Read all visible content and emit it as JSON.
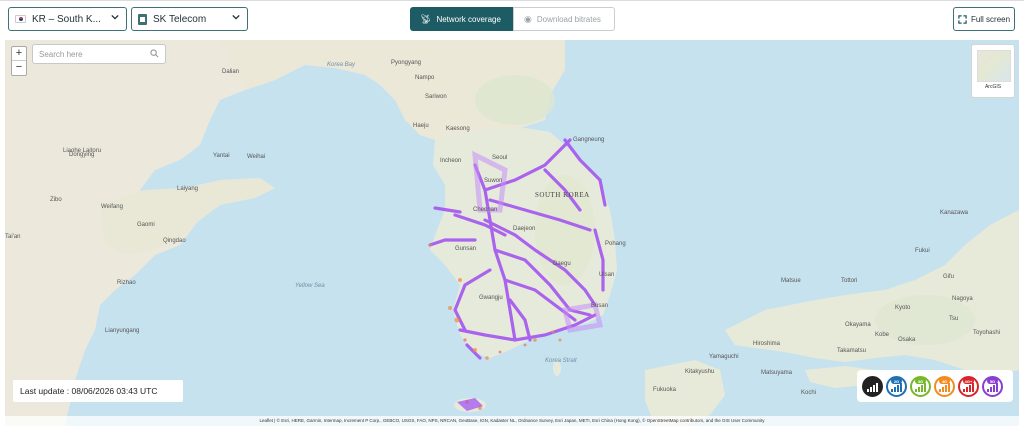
{
  "header": {
    "country_select": "KR – South K...",
    "operator_select": "SK Telecom",
    "tab_network": "Network coverage",
    "tab_bitrates": "Download bitrates",
    "fullscreen": "Full screen"
  },
  "map": {
    "zoom_in": "+",
    "zoom_out": "−",
    "search_placeholder": "Search here",
    "basemap_caption": "ArcGIS",
    "last_update": "Last update : 08/06/2026 03:43 UTC",
    "attribution": "Leaflet | © Esri, HERE, Garmin, Intermap, Increment P Corp., GEBCO, USGS, FAO, NPS, NRCAN, GeoBase, IGN, Kadaster NL, Ordnance Survey, Esri Japan, METI, Esri China (Hong Kong), © OpenStreetMap contributors, and the GIS User Community",
    "places": [
      {
        "name": "Dalian"
      },
      {
        "name": "Korea Bay"
      },
      {
        "name": "Pyongyang"
      },
      {
        "name": "Nampo"
      },
      {
        "name": "Sariwon"
      },
      {
        "name": "Haeju"
      },
      {
        "name": "Kaesong"
      },
      {
        "name": "Incheon"
      },
      {
        "name": "Seoul"
      },
      {
        "name": "Suwon"
      },
      {
        "name": "Gangneung"
      },
      {
        "name": "SOUTH KOREA"
      },
      {
        "name": "Cheonan"
      },
      {
        "name": "Daejeon"
      },
      {
        "name": "Pohang"
      },
      {
        "name": "Gunsan"
      },
      {
        "name": "Daegu"
      },
      {
        "name": "Ulsan"
      },
      {
        "name": "Gwangju"
      },
      {
        "name": "Busan"
      },
      {
        "name": "Liaohe Laitoru"
      },
      {
        "name": "Yantai"
      },
      {
        "name": "Weihai"
      },
      {
        "name": "Dongying"
      },
      {
        "name": "Laiyang"
      },
      {
        "name": "Zibo"
      },
      {
        "name": "Weifang"
      },
      {
        "name": "Gaomi"
      },
      {
        "name": "Qingdao"
      },
      {
        "name": "Tai'an"
      },
      {
        "name": "Rizhao"
      },
      {
        "name": "Lianyungang"
      },
      {
        "name": "Yellow Sea"
      },
      {
        "name": "Korea Strait"
      },
      {
        "name": "Fukuoka"
      },
      {
        "name": "Kitakyushu"
      },
      {
        "name": "Hiroshima"
      },
      {
        "name": "Matsue"
      },
      {
        "name": "Tottori"
      },
      {
        "name": "Kyoto"
      },
      {
        "name": "Nagoya"
      },
      {
        "name": "Okayama"
      },
      {
        "name": "Kobe"
      },
      {
        "name": "Osaka"
      },
      {
        "name": "Kanazawa"
      },
      {
        "name": "Fukui"
      },
      {
        "name": "Gifu"
      },
      {
        "name": "Matsuyama"
      },
      {
        "name": "Takamatsu"
      },
      {
        "name": "Kochi"
      },
      {
        "name": "Toyohashi"
      },
      {
        "name": "Yamaguchi"
      },
      {
        "name": "Tsu"
      }
    ]
  },
  "legend": {
    "items": [
      {
        "icon": "all-networks-icon",
        "label": "",
        "color": "#222222"
      },
      {
        "icon": "2g-icon",
        "label": "2G",
        "color": "#1f6fb3"
      },
      {
        "icon": "3g-icon",
        "label": "3G",
        "color": "#76b82a"
      },
      {
        "icon": "4g-icon",
        "label": "4G",
        "color": "#f28c1e"
      },
      {
        "icon": "4g-plus-icon",
        "label": "4G+",
        "color": "#d7262a"
      },
      {
        "icon": "5g-icon",
        "label": "5G",
        "color": "#8a3dd1"
      }
    ]
  },
  "colors": {
    "accent": "#1d5c64",
    "coverage": "#a455ef",
    "coverage_alt": "#f08a3c",
    "sea": "#c6e2ef",
    "land": "#e8ecdf"
  }
}
